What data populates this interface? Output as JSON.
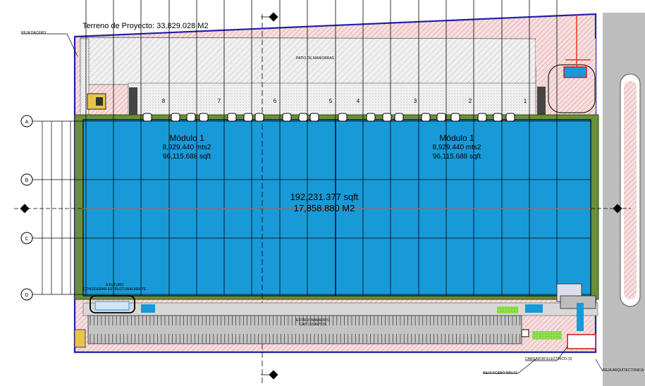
{
  "terrain_label": "Terreno de Proyecto: 33,829.028 M2",
  "modules": [
    {
      "name": "Módulo 1",
      "area_m2": "8,929.440 mts2",
      "area_sqft": "96,115.688 sqft"
    },
    {
      "name": "Módulo 1",
      "area_m2": "8,929.440 mts2",
      "area_sqft": "96,115.688 sqft"
    }
  ],
  "total_sqft": "192,231.377 sqft",
  "total_m2": "17,858.880 M2",
  "patio_label": "PATIO DE MANIOBRAS",
  "parking_label": "ESTACIONAMIENTO",
  "parking_capacity": "CAP. 115 AUTOS",
  "fence_labels": {
    "top_left": "REJA DACERO",
    "bottom": "REJA ACERO IMN.02",
    "bottom_right": "REJA ARQUITECTONICA"
  },
  "charger_label": "CARGADOR ELECTRICO (3)",
  "future_label": [
    "A FUTURO",
    "CONSIDERAR ESTRUCTURALMENTE"
  ],
  "grid_rows": [
    "A",
    "B",
    "C",
    "D"
  ],
  "dock_numbers": [
    "8",
    "7",
    "6",
    "5",
    "4",
    "3",
    "2",
    "1"
  ],
  "colors": {
    "warehouse": "#199ad8",
    "site_hatch": "#f2d2d2",
    "boundary": "#1f1fa8",
    "slab": "#6b8e3a",
    "road": "#bdbdbd",
    "parking_green": "#8fe04a"
  }
}
